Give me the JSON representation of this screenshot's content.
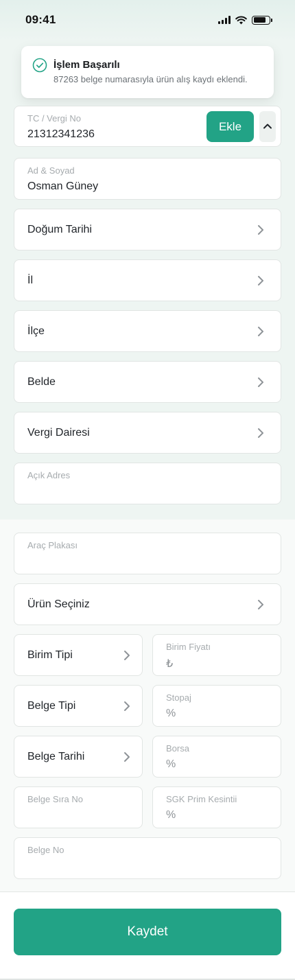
{
  "status_bar": {
    "time": "09:41"
  },
  "toast": {
    "title": "İşlem Başarılı",
    "message": "87263 belge numarasıyla ürün alış kaydı eklendi."
  },
  "customer": {
    "tc_vergi_no": {
      "label": "TC / Vergi No",
      "value": "21312341236"
    },
    "add_button": "Ekle",
    "ad_soyad": {
      "label": "Ad & Soyad",
      "value": "Osman Güney"
    },
    "dogum_tarihi": "Doğum Tarihi",
    "il": "İl",
    "ilce": "İlçe",
    "belde": "Belde",
    "vergi_dairesi": "Vergi Dairesi",
    "acik_adres": {
      "label": "Açık Adres",
      "value": ""
    }
  },
  "purchase": {
    "arac_plakasi": {
      "label": "Araç Plakası",
      "value": ""
    },
    "urun_seciniz": "Ürün Seçiniz",
    "birim_tipi": "Birim Tipi",
    "birim_fiyati": {
      "label": "Birim Fiyatı",
      "value": "₺"
    },
    "belge_tipi": "Belge Tipi",
    "stopaj": {
      "label": "Stopaj",
      "value": "%"
    },
    "belge_tarihi": "Belge Tarihi",
    "borsa": {
      "label": "Borsa",
      "value": "%"
    },
    "belge_sira_no": {
      "label": "Belge Sıra No",
      "value": ""
    },
    "sgk_prim_kesintisi": {
      "label": "SGK Prim Kesintii",
      "value": "%"
    },
    "belge_no": {
      "label": "Belge No",
      "value": ""
    }
  },
  "footer": {
    "save_label": "Kaydet"
  },
  "colors": {
    "accent": "#22a386",
    "success_icon": "#22a386"
  },
  "icons": {
    "toast": "check-circle-icon",
    "chevron": "chevron-right-icon",
    "collapse": "chevron-up-icon"
  }
}
